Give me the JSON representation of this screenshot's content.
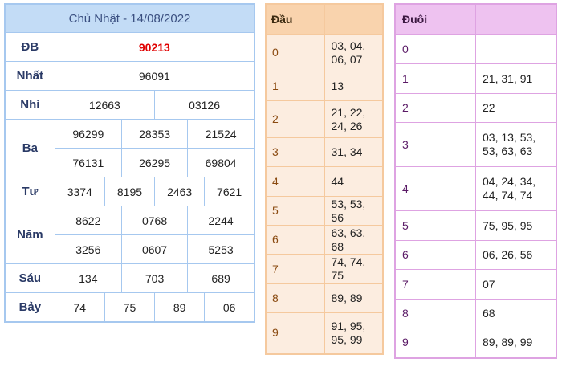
{
  "results": {
    "title": "Chủ Nhật - 14/08/2022",
    "labels": {
      "db": "ĐB",
      "nhat": "Nhất",
      "nhi": "Nhì",
      "ba": "Ba",
      "tu": "Tư",
      "nam": "Năm",
      "sau": "Sáu",
      "bay": "Bảy"
    },
    "db": "90213",
    "nhat": "96091",
    "nhi": [
      "12663",
      "03126"
    ],
    "ba": [
      "96299",
      "28353",
      "21524",
      "76131",
      "26295",
      "69804"
    ],
    "tu": [
      "3374",
      "8195",
      "2463",
      "7621"
    ],
    "nam": [
      "8622",
      "0768",
      "2244",
      "3256",
      "0607",
      "5253"
    ],
    "sau": [
      "134",
      "703",
      "689"
    ],
    "bay": [
      "74",
      "75",
      "89",
      "06"
    ]
  },
  "dau": {
    "header": "Đầu",
    "rows": [
      {
        "key": "0",
        "values": "03, 04, 06, 07"
      },
      {
        "key": "1",
        "values": "13"
      },
      {
        "key": "2",
        "values": "21, 22, 24, 26"
      },
      {
        "key": "3",
        "values": "31, 34"
      },
      {
        "key": "4",
        "values": "44"
      },
      {
        "key": "5",
        "values": "53, 53, 56"
      },
      {
        "key": "6",
        "values": "63, 63, 68"
      },
      {
        "key": "7",
        "values": "74, 74, 75"
      },
      {
        "key": "8",
        "values": "89, 89"
      },
      {
        "key": "9",
        "values": "91, 95, 95, 99"
      }
    ]
  },
  "duoi": {
    "header": "Đuôi",
    "rows": [
      {
        "key": "0",
        "values": ""
      },
      {
        "key": "1",
        "values": "21, 31, 91"
      },
      {
        "key": "2",
        "values": "22"
      },
      {
        "key": "3",
        "values": "03, 13, 53, 53, 63, 63"
      },
      {
        "key": "4",
        "values": "04, 24, 34, 44, 74, 74"
      },
      {
        "key": "5",
        "values": "75, 95, 95"
      },
      {
        "key": "6",
        "values": "06, 26, 56"
      },
      {
        "key": "7",
        "values": "07"
      },
      {
        "key": "8",
        "values": "68"
      },
      {
        "key": "9",
        "values": "89, 89, 99"
      }
    ]
  },
  "colors": {
    "results_border": "#a6c8ef",
    "results_header_bg": "#c3dcf6",
    "special_prize": "#e00000",
    "dau_border": "#f5c99e",
    "dau_bg": "#fcede0",
    "duoi_border": "#dea3e2",
    "duoi_header_bg": "#eec2f0"
  }
}
